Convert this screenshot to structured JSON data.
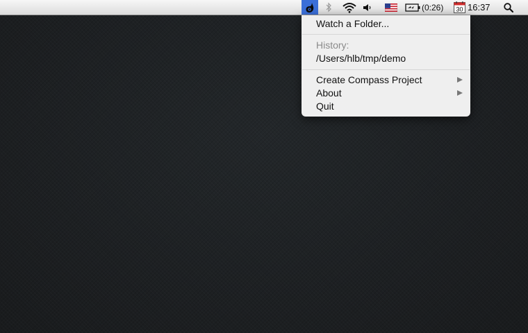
{
  "menubar": {
    "app_icon": "compass-droplet-icon",
    "status_icons": [
      "bluetooth-icon",
      "wifi-icon",
      "volume-icon",
      "us-flag-icon",
      "battery-charging-icon",
      "calendar-icon",
      "spotlight-search-icon"
    ],
    "battery_time": "(0:26)",
    "calendar_day": "30",
    "clock": "16:37"
  },
  "menu": {
    "watch_folder": "Watch a Folder...",
    "history_header": "History:",
    "history_items": [
      "/Users/hlb/tmp/demo"
    ],
    "create_project": "Create Compass Project",
    "about": "About",
    "quit": "Quit"
  },
  "colors": {
    "menu_bg": "#f4f4f4",
    "app_icon_highlight": "#3b6fd8",
    "desktop": "#1c1f21"
  }
}
